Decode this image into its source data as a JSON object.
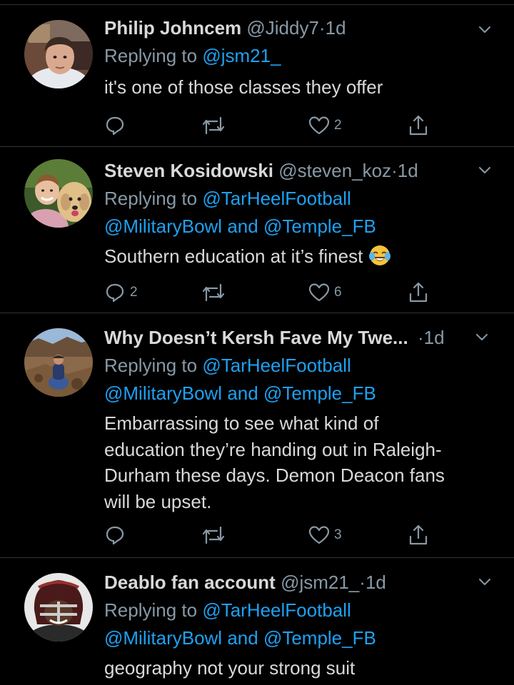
{
  "colors": {
    "background": "#000000",
    "divider": "#2f3336",
    "text": "#d9d9d9",
    "muted": "#8899a6",
    "link": "#1da1f2"
  },
  "tweets": [
    {
      "name": "Philip Johncem",
      "handle": "@Jiddy7",
      "dot": "·",
      "time": "1d",
      "replying_prefix": "Replying to",
      "replying_line1": "@jsm21_",
      "replying_line2_a": "",
      "replying_line2_and": "",
      "replying_line2_b": "",
      "text": "it's one of those classes they offer",
      "reply_count": "",
      "retweet_count": "",
      "like_count": "2",
      "avatar_icon": "avatar-young-man-icon"
    },
    {
      "name": "Steven Kosidowski",
      "handle": "@steven_koz",
      "dot": "·",
      "time": "1d",
      "replying_prefix": "Replying to",
      "replying_line1": "@TarHeelFootball",
      "replying_line2_a": "@MilitaryBowl",
      "replying_line2_and": "and",
      "replying_line2_b": "@Temple_FB",
      "text": "Southern education at it’s finest",
      "emoji": "laughing-tears-emoji",
      "reply_count": "2",
      "retweet_count": "",
      "like_count": "6",
      "avatar_icon": "avatar-man-with-dog-icon"
    },
    {
      "name": "Why Doesn’t Kersh Fave My Twe...",
      "handle": "",
      "dot": "·",
      "time": "1d",
      "replying_prefix": "Replying to",
      "replying_line1": "@TarHeelFootball",
      "replying_line2_a": "@MilitaryBowl",
      "replying_line2_and": "and",
      "replying_line2_b": "@Temple_FB",
      "text_lines": [
        "Embarrassing to see what kind of",
        "education they’re handing out in Raleigh-",
        "Durham these days. Demon Deacon fans",
        "will be upset."
      ],
      "reply_count": "",
      "retweet_count": "",
      "like_count": "3",
      "avatar_icon": "avatar-hiker-rocks-icon"
    },
    {
      "name": "Deablo fan account",
      "handle": "@jsm21_",
      "dot": "·",
      "time": "1d",
      "replying_prefix": "Replying to",
      "replying_line1": "@TarHeelFootball",
      "replying_line2_a": "@MilitaryBowl",
      "replying_line2_and": "and",
      "replying_line2_b": "@Temple_FB",
      "text": "geography not your strong suit",
      "avatar_icon": "avatar-football-helmet-icon"
    }
  ]
}
